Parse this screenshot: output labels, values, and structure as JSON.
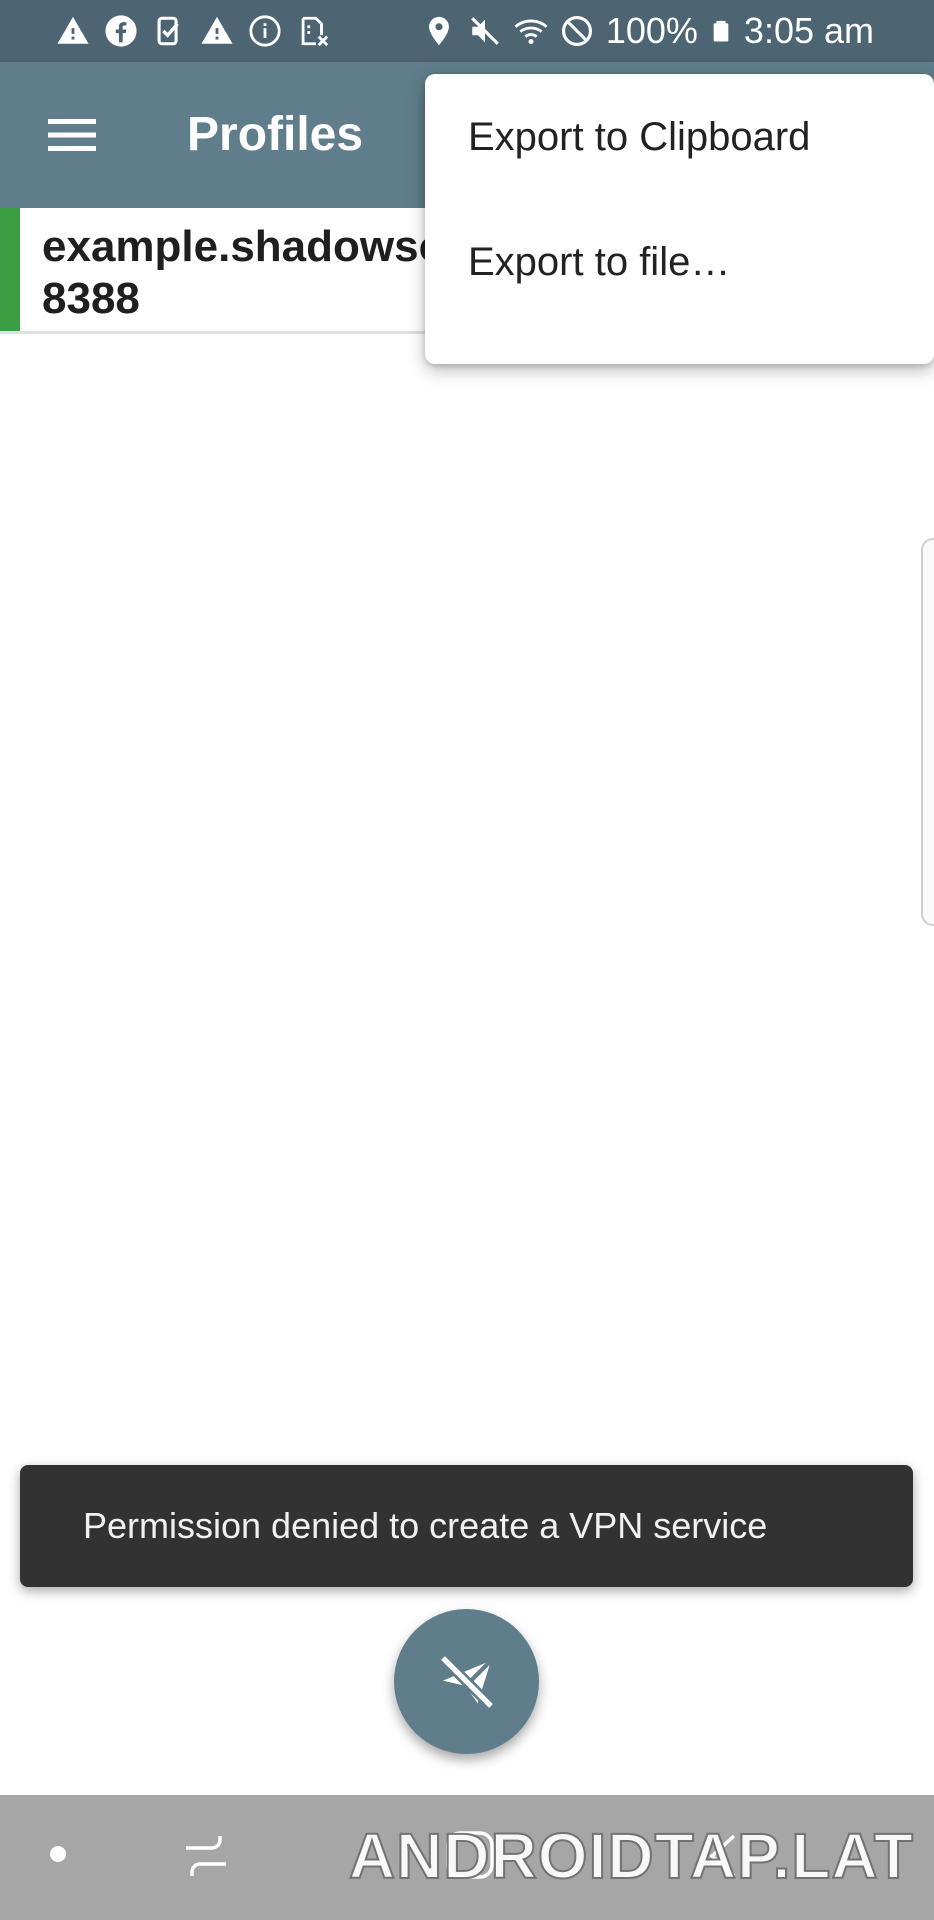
{
  "status_bar": {
    "left_icons": [
      "warning-icon",
      "facebook-icon",
      "task-check-icon",
      "warning-icon",
      "info-icon",
      "sim-off-icon"
    ],
    "right_icons": [
      "location-icon",
      "mute-icon",
      "wifi-icon",
      "do-not-disturb-icon",
      "battery-icon"
    ],
    "battery": "100%",
    "time": "3:05 am"
  },
  "app_bar": {
    "title": "Profiles",
    "menu_icon": "hamburger-menu-icon",
    "background": "#607d8b"
  },
  "profiles": [
    {
      "host": "example.shadowsocks.org",
      "host_visible": "example.shadows",
      "port": "8388",
      "accent": "#3a9d41"
    }
  ],
  "dropdown_menu": {
    "items": [
      {
        "label": "Export to Clipboard"
      },
      {
        "label": "Export to file…"
      }
    ]
  },
  "snackbar": {
    "message": "Permission denied to create a VPN service"
  },
  "fab": {
    "icon": "paper-plane-off-icon",
    "background": "#607d8b"
  },
  "nav_bar": {
    "icons": [
      "dot-icon",
      "recents-icon",
      "home-icon",
      "back-icon"
    ],
    "watermark": "ANDROIDTAP.LAT"
  }
}
